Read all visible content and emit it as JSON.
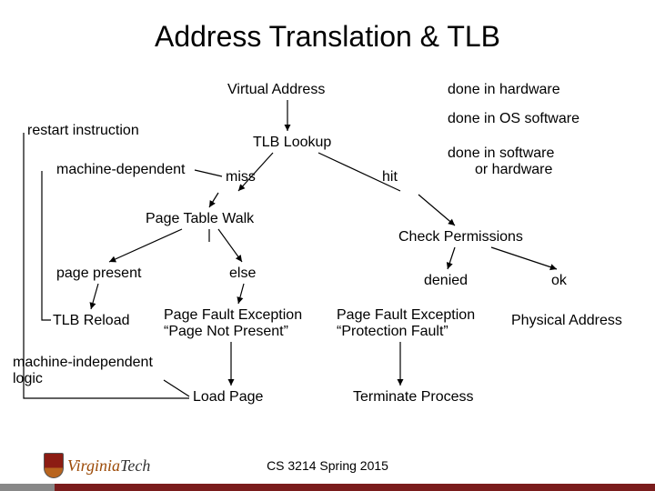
{
  "title": "Address Translation & TLB",
  "nodes": {
    "virtual_address": "Virtual Address",
    "tlb_lookup": "TLB Lookup",
    "restart_instruction": "restart instruction",
    "machine_dependent": "machine-dependent",
    "miss": "miss",
    "hit": "hit",
    "page_table_walk": "Page Table Walk",
    "check_permissions": "Check Permissions",
    "page_present": "page present",
    "else": "else",
    "denied": "denied",
    "ok": "ok",
    "tlb_reload": "TLB Reload",
    "page_fault_not_present_l1": "Page Fault Exception",
    "page_fault_not_present_l2": "“Page Not Present”",
    "page_fault_protection_l1": "Page Fault Exception",
    "page_fault_protection_l2": "“Protection Fault”",
    "physical_address": "Physical Address",
    "machine_independent_l1": "machine-independent",
    "machine_independent_l2": "logic",
    "load_page": "Load Page",
    "terminate_process": "Terminate Process"
  },
  "legend": {
    "hw": "done in hardware",
    "os": "done in OS software",
    "sw_or_hw_l1": "done in software",
    "sw_or_hw_l2": "or hardware"
  },
  "footer": "CS 3214 Spring 2015",
  "logo_text": "VirginiaTech"
}
